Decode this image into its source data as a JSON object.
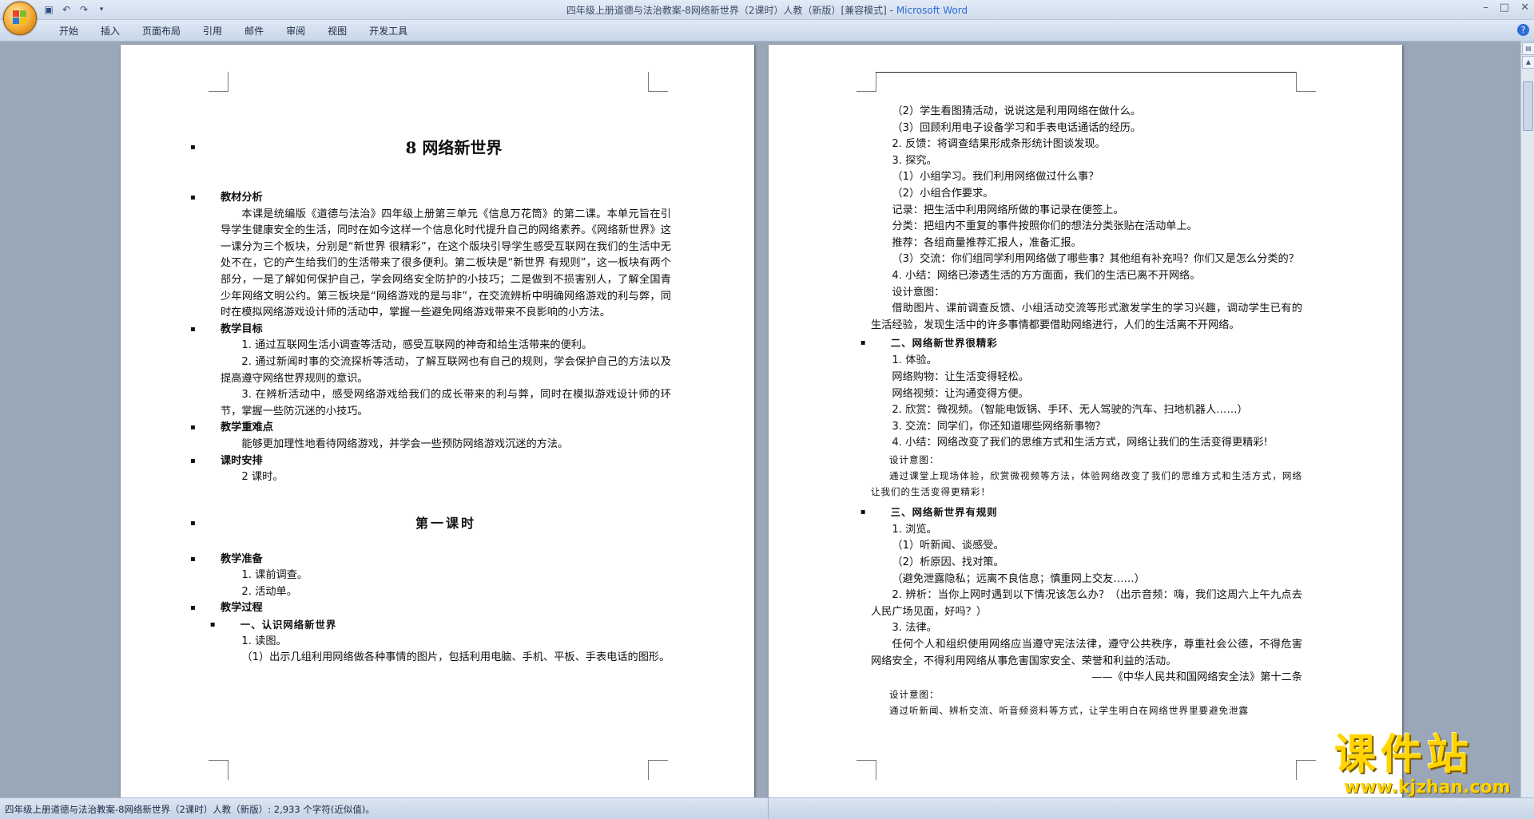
{
  "window": {
    "title": "四年级上册道德与法治教案-8网络新世界（2课时）人教（新版）[兼容模式] -",
    "app_name": "Microsoft Word"
  },
  "menu": [
    "开始",
    "插入",
    "页面布局",
    "引用",
    "邮件",
    "审阅",
    "视图",
    "开发工具"
  ],
  "icons": {
    "office": "office-button-icon",
    "save": "save-icon",
    "undo": "undo-icon",
    "redo": "redo-icon",
    "help": "help-icon"
  },
  "page1": {
    "title": "8 网络新世界",
    "s1_head": "教材分析",
    "s1_body": "本课是统编版《道德与法治》四年级上册第三单元《信息万花筒》的第二课。本单元旨在引导学生健康安全的生活，同时在如今这样一个信息化时代提升自己的网络素养。《网络新世界》这一课分为三个板块，分别是“新世界 很精彩”，在这个版块引导学生感受互联网在我们的生活中无处不在，它的产生给我们的生活带来了很多便利。第二板块是“新世界 有规则”，这一板块有两个部分，一是了解如何保护自己，学会网络安全防护的小技巧；二是做到不损害别人，了解全国青少年网络文明公约。第三板块是“网络游戏的是与非”，在交流辨析中明确网络游戏的利与弊，同时在模拟网络游戏设计师的活动中，掌握一些避免网络游戏带来不良影响的小方法。",
    "s2_head": "教学目标",
    "goal1": "1. 通过互联网生活小调查等活动，感受互联网的神奇和给生活带来的便利。",
    "goal2": "2. 通过新闻时事的交流探析等活动，了解互联网也有自己的规则，学会保护自己的方法以及提高遵守网络世界规则的意识。",
    "goal3": "3. 在辨析活动中，感受网络游戏给我们的成长带来的利与弊，同时在模拟游戏设计师的环节，掌握一些防沉迷的小技巧。",
    "s3_head": "教学重难点",
    "s3_body": "能够更加理性地看待网络游戏，并学会一些预防网络游戏沉迷的方法。",
    "s4_head": "课时安排",
    "s4_body": "2 课时。",
    "lesson": "第一课时",
    "s5_head": "教学准备",
    "prep1": "1. 课前调查。",
    "prep2": "2. 活动单。",
    "s6_head": "教学过程",
    "part1": "一、认识网络新世界",
    "read": "1. 读图。",
    "read1": "（1）出示几组利用网络做各种事情的图片，包括利用电脑、手机、平板、手表电话的图形。"
  },
  "page2": {
    "l1": "（2）学生看图猜活动，说说这是利用网络在做什么。",
    "l2": "（3）回顾利用电子设备学习和手表电话通话的经历。",
    "l3": "2. 反馈：将调查结果形成条形统计图谈发现。",
    "l4": "3. 探究。",
    "l5": "（1）小组学习。我们利用网络做过什么事？",
    "l6": "（2）小组合作要求。",
    "l7": "记录：把生活中利用网络所做的事记录在便签上。",
    "l8": "分类：把组内不重复的事件按照你们的想法分类张贴在活动单上。",
    "l9": "推荐：各组商量推荐汇报人，准备汇报。",
    "l10": "（3）交流：你们组同学利用网络做了哪些事？其他组有补充吗？你们又是怎么分类的？",
    "l11": "4. 小结：网络已渗透生活的方方面面，我们的生活已离不开网络。",
    "l12": "设计意图：",
    "l13": "借助图片、课前调查反馈、小组活动交流等形式激发学生的学习兴趣，调动学生已有的生活经验，发现生活中的许多事情都要借助网络进行，人们的生活离不开网络。",
    "part2": "二、网络新世界很精彩",
    "m1": "1. 体验。",
    "m2": "网络购物：让生活变得轻松。",
    "m3": "网络视频：让沟通变得方便。",
    "m4": "2. 欣赏：微视频。（智能电饭锅、手环、无人驾驶的汽车、扫地机器人……）",
    "m5": "3. 交流：同学们，你还知道哪些网络新事物？",
    "m6": "4. 小结：网络改变了我们的思维方式和生活方式，网络让我们的生活变得更精彩!",
    "m7": "设计意图：",
    "m8": "通过课堂上现场体验，欣赏微视频等方法，体验网络改变了我们的思维方式和生活方式，网络让我们的生活变得更精彩！",
    "part3": "三、网络新世界有规则",
    "n1": "1. 浏览。",
    "n2": "（1）听新闻、谈感受。",
    "n3": "（2）析原因、找对策。",
    "n4": "（避免泄露隐私；远离不良信息；慎重网上交友……）",
    "n5": "2. 辨析：当你上网时遇到以下情况该怎么办？（出示音频：嗨，我们这周六上午九点去人民广场见面，好吗？）",
    "n6": "3. 法律。",
    "n7": "任何个人和组织使用网络应当遵守宪法法律，遵守公共秩序，尊重社会公德，不得危害网络安全，不得利用网络从事危害国家安全、荣誉和利益的活动。",
    "n8": "——《中华人民共和国网络安全法》第十二条",
    "n9": "设计意图：",
    "n10": "通过听新闻、辨析交流、听音频资料等方式，让学生明白在网络世界里要避免泄露"
  },
  "status": {
    "text": "四年级上册道德与法治教案-8网络新世界（2课时）人教（新版）: 2,933 个字符(近似值)。"
  },
  "watermark": {
    "brand": "课件站",
    "url": "www.kjzhan.com"
  }
}
